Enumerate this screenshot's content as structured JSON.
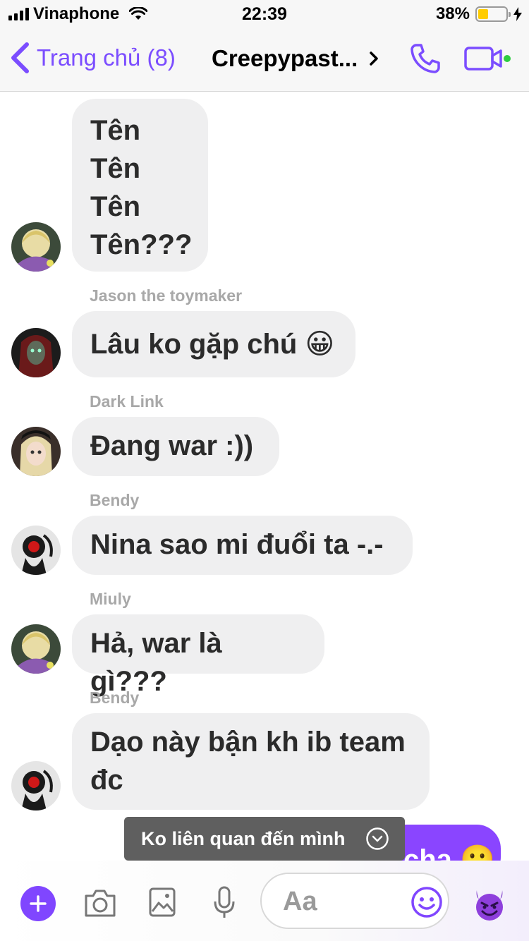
{
  "status_bar": {
    "carrier": "Vinaphone",
    "time": "22:39",
    "battery_percent": "38%",
    "battery_level": 0.38
  },
  "nav": {
    "back_label": "Trang chủ (8)",
    "title": "Creepypast..."
  },
  "messages": [
    {
      "sender": "",
      "lines": [
        "Tên",
        "Tên",
        "Tên",
        "Tên???"
      ]
    },
    {
      "sender": "Jason the toymaker",
      "text": "Lâu ko gặp chú 😀"
    },
    {
      "sender": "Dark Link",
      "text": "Đang war :))"
    },
    {
      "sender": "Bendy",
      "text": "Nina sao mi đuổi ta -.-"
    },
    {
      "sender": "Miuly",
      "text": "Hả, war là gì???"
    },
    {
      "sender": "Bendy",
      "lines": [
        "Dạo này bận kh ib team",
        "đc"
      ]
    }
  ],
  "outgoing_partial": "cha 🙂",
  "toast": "Ko liên quan đến mình",
  "composer": {
    "placeholder": "Aa"
  },
  "colors": {
    "accent": "#7b4dff",
    "outgoing_bubble": "#8a45ff",
    "incoming_bubble": "#efeff0",
    "toast_bg": "#5f5f5f"
  }
}
